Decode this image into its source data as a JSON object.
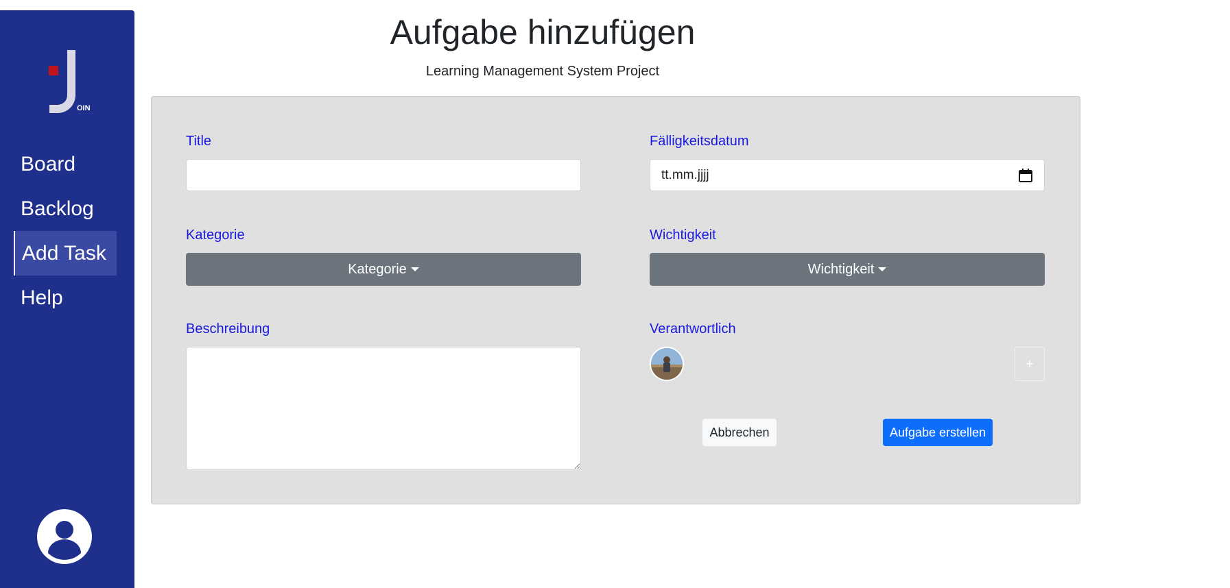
{
  "sidebar": {
    "logo_text": "OIN",
    "items": [
      {
        "label": "Board"
      },
      {
        "label": "Backlog"
      },
      {
        "label": "Add Task",
        "active": true
      },
      {
        "label": "Help"
      }
    ],
    "user_icon": "user-circle-icon"
  },
  "header": {
    "title": "Aufgabe hinzufügen",
    "subtitle": "Learning Management System Project"
  },
  "form": {
    "title_label": "Title",
    "title_value": "",
    "due_label": "Fälligkeitsdatum",
    "due_placeholder": "tt.mm.jjjj",
    "category_label": "Kategorie",
    "category_button": "Kategorie",
    "priority_label": "Wichtigkeit",
    "priority_button": "Wichtigkeit",
    "description_label": "Beschreibung",
    "description_value": "",
    "assignee_label": "Verantwortlich",
    "add_assignee": "+",
    "cancel_button": "Abbrechen",
    "submit_button": "Aufgabe erstellen"
  },
  "colors": {
    "sidebar": "#1f2f8c",
    "label": "#1a1adc",
    "dropdown": "#6c757d",
    "primary": "#0d6efd",
    "card": "#e0e0e0"
  }
}
